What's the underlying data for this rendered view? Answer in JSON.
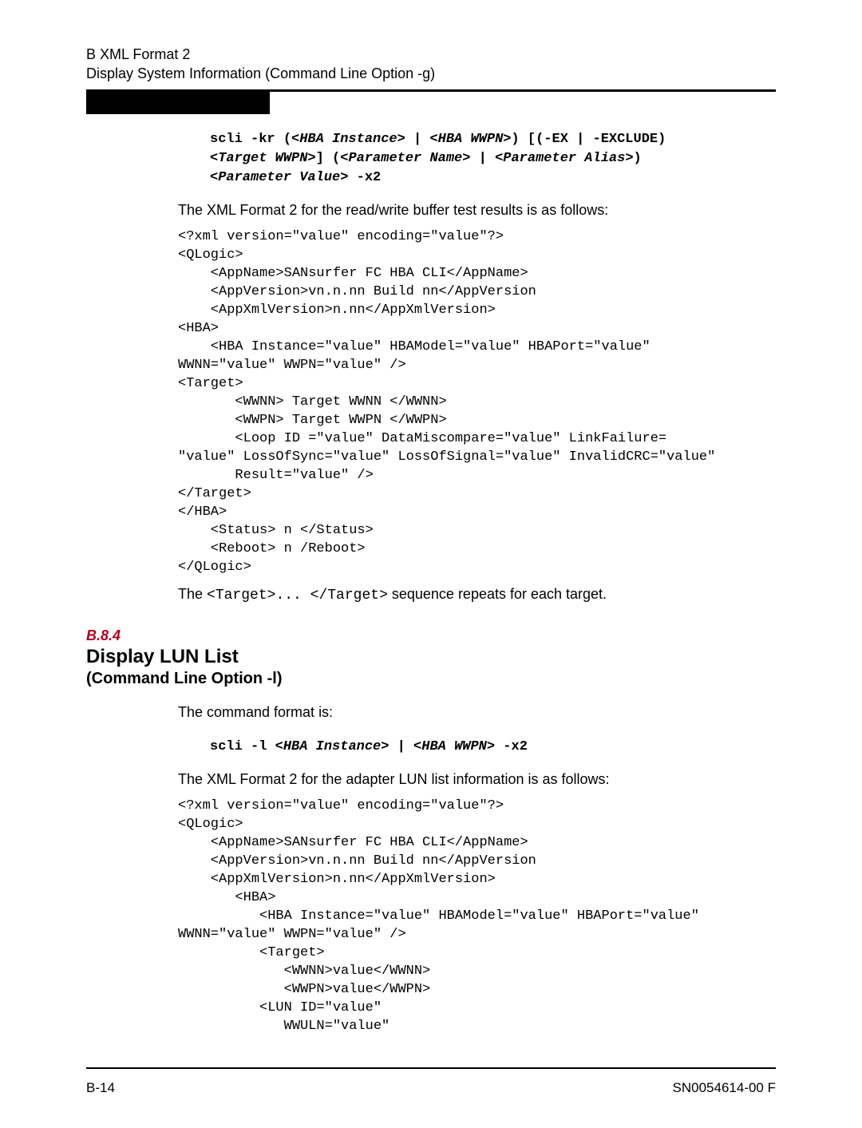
{
  "header": {
    "line1": "B   XML Format 2",
    "line2": "Display System Information (Command Line Option -g)"
  },
  "cmd1": {
    "p1": "scli -kr (<",
    "i1": "HBA Instance",
    "p2": "> | <",
    "i2": "HBA WWPN",
    "p3": ">) [(-EX | -EXCLUDE)",
    "p4": "<",
    "i3": "Target WWPN",
    "p5": ">] (<",
    "i4": "Parameter Name",
    "p6": "> | <",
    "i5": "Parameter Alias",
    "p7": ">)",
    "p8": "<",
    "i6": "Parameter Value",
    "p9": "> -x2"
  },
  "para1": "The XML Format 2 for the read/write buffer test results is as follows:",
  "xml1": "<?xml version=\"value\" encoding=\"value\"?>\n<QLogic>\n    <AppName>SANsurfer FC HBA CLI</AppName>\n    <AppVersion>vn.n.nn Build nn</AppVersion\n    <AppXmlVersion>n.nn</AppXmlVersion>\n<HBA>\n    <HBA Instance=\"value\" HBAModel=\"value\" HBAPort=\"value\" \nWWNN=\"value\" WWPN=\"value\" />\n<Target>\n       <WWNN> Target WWNN </WWNN>\n       <WWPN> Target WWPN </WWPN>\n       <Loop ID =\"value\" DataMiscompare=\"value\" LinkFailure= \n\"value\" LossOfSync=\"value\" LossOfSignal=\"value\" InvalidCRC=\"value\"\n       Result=\"value\" />\n</Target>\n</HBA>\n    <Status> n </Status>\n    <Reboot> n /Reboot>\n</QLogic>",
  "para2_a": "The ",
  "para2_m": "<Target>... </Target>",
  "para2_b": " sequence repeats for each target.",
  "sec": {
    "num": "B.8.4",
    "title": "Display LUN List",
    "sub": "(Command Line Option -l)"
  },
  "para3": "The command format is:",
  "cmd2": {
    "p1": "scli -l <",
    "i1": "HBA Instance",
    "p2": "> | <",
    "i2": "HBA WWPN",
    "p3": "> -x2"
  },
  "para4": "The XML Format 2 for the adapter LUN list information is as follows:",
  "xml2": "<?xml version=\"value\" encoding=\"value\"?>\n<QLogic>\n    <AppName>SANsurfer FC HBA CLI</AppName>\n    <AppVersion>vn.n.nn Build nn</AppVersion\n    <AppXmlVersion>n.nn</AppXmlVersion>\n       <HBA>\n          <HBA Instance=\"value\" HBAModel=\"value\" HBAPort=\"value\" \nWWNN=\"value\" WWPN=\"value\" />\n          <Target>\n             <WWNN>value</WWNN>\n             <WWPN>value</WWPN>\n          <LUN ID=\"value\"\n             WWULN=\"value\"",
  "footer": {
    "left": "B-14",
    "right": "SN0054614-00  F"
  }
}
